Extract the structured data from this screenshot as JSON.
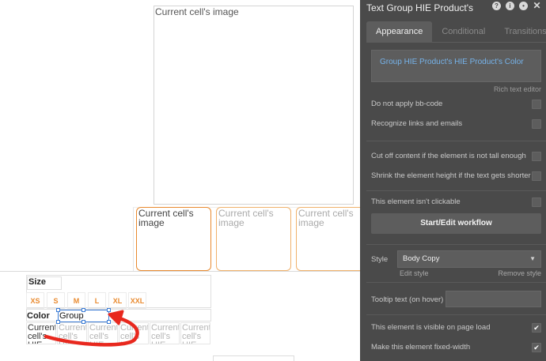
{
  "canvas": {
    "main_image_label": "Current cell's image",
    "thumbnails": [
      {
        "label": "Current cell's image",
        "selected": true
      },
      {
        "label": "Current cell's image",
        "selected": false
      },
      {
        "label": "Current cell's image",
        "selected": false
      }
    ],
    "size_label": "Size",
    "sizes": [
      "XS",
      "S",
      "M",
      "L",
      "XL",
      "XXL"
    ],
    "color_label": "Color",
    "selected_group_label": "Group HIE...",
    "color_cells": [
      "Current cell's HIE",
      "Current cell's HIE",
      "Current cell's HIE",
      "Current cell's HIE",
      "Current cell's HIE",
      "Current cell's HIE"
    ],
    "accent_color": "#e98a2f",
    "selection_color": "#3a7bd5",
    "annotation_color": "#e8281e"
  },
  "panel": {
    "title": "Text Group HIE Product's",
    "header_icons": [
      "help-icon",
      "info-icon",
      "comment-icon",
      "close-icon"
    ],
    "tabs": [
      {
        "label": "Appearance",
        "active": true
      },
      {
        "label": "Conditional",
        "active": false
      },
      {
        "label": "Transitions",
        "active": false
      }
    ],
    "content_text": "Group HIE Product's HIE Product's Color",
    "rich_text_editor_label": "Rich text editor",
    "options": [
      {
        "label": "Do not apply bb-code",
        "checked": false
      },
      {
        "label": "Recognize links and emails",
        "checked": false
      },
      {
        "label": "Cut off content if the element is not tall enough",
        "checked": false
      },
      {
        "label": "Shrink the element height if the text gets shorter",
        "checked": false
      },
      {
        "label": "This element isn't clickable",
        "checked": false
      }
    ],
    "workflow_button": "Start/Edit workflow",
    "style_label": "Style",
    "style_value": "Body Copy",
    "edit_style": "Edit style",
    "remove_style": "Remove style",
    "tooltip_label": "Tooltip text (on hover)",
    "tooltip_value": "",
    "bottom_options": [
      {
        "label": "This element is visible on page load",
        "checked": true
      },
      {
        "label": "Make this element fixed-width",
        "checked": true
      }
    ],
    "link_color": "#76b3ea"
  }
}
